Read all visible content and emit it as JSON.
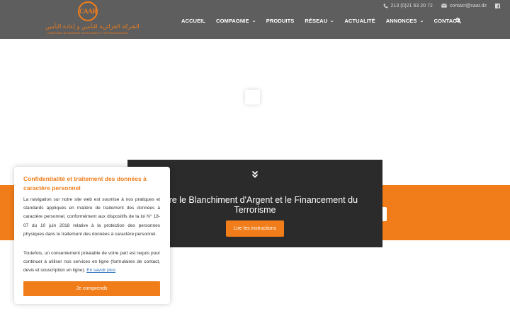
{
  "header": {
    "logo": {
      "emblem_text": "CAAR",
      "arabic_name": "الشركة الجزائرية للتأمين و إعادة التأمين",
      "french_name": "COMPAGNIE ALGERIENNE D'ASSURANCE ET DE REASSURANCE"
    },
    "topbar": {
      "phone": "213 (0)21 63 20 72",
      "email": "contact@caar.dz",
      "phone_icon": "phone-icon",
      "email_icon": "envelope-icon",
      "social_icon": "facebook-icon"
    },
    "nav": {
      "items": [
        {
          "label": "ACCUEIL",
          "dropdown": false
        },
        {
          "label": "COMPAGNIE",
          "dropdown": true
        },
        {
          "label": "PRODUITS",
          "dropdown": false
        },
        {
          "label": "RÉSEAU",
          "dropdown": true
        },
        {
          "label": "ACTUALITÉ",
          "dropdown": false
        },
        {
          "label": "ANNONCES",
          "dropdown": true
        },
        {
          "label": "CONTACT",
          "dropdown": false
        }
      ],
      "chevron_glyph": "⌄",
      "search_icon": "search-icon"
    }
  },
  "modal": {
    "title_line1": "contre le Blanchiment d'Argent et le Financement du",
    "title_line2": "Terrorisme",
    "button_label": "Lire les instructions"
  },
  "cookie_notice": {
    "title": "Confidentialité et traitement des données à caractère personnel",
    "paragraph1": "La navigation sur notre site web est soumise à nos pratiques et standards appliqués en matière de traitement des données à caractère personnel, conformément aux dispositifs de la loi N° 18-07 du 10 juin 2018 relative à la protection des personnes physiques dans le traitement des données à caractère personnel.",
    "paragraph2": "Toutefois, un consentement préalable de votre part est requis pour continuer à utiliser nos services en ligne (formulaires de contact, devis et souscription en ligne).",
    "link_label": "En savoir plus",
    "accept_label": "Je comprends"
  },
  "colors": {
    "brand_orange": "#f07d1a",
    "header_gray": "#5e5e5e",
    "modal_dark": "#2b2b2b",
    "link_blue": "#2a6ebd"
  }
}
